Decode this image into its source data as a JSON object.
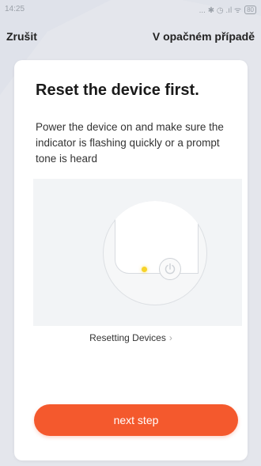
{
  "status_bar": {
    "time": "14:25",
    "icons": "... ✱ ◷ .ıl ᯤ",
    "battery": "80"
  },
  "nav": {
    "cancel_label": "Zrušit",
    "other_label": "V opačném případě"
  },
  "card": {
    "title": "Reset the device first.",
    "description": "Power the device on and make sure the indicator is flashing quickly or a prompt tone is heard",
    "reset_link_label": "Resetting Devices",
    "reset_link_chevron": "›",
    "next_button_label": "next step"
  },
  "colors": {
    "accent": "#f4592d",
    "indicator": "#f7d32a",
    "background": "#e4e6ec"
  },
  "icons": [
    "power-icon",
    "chevron-right-icon",
    "battery-icon",
    "wifi-icon",
    "signal-icon",
    "alarm-icon",
    "bluetooth-icon"
  ]
}
